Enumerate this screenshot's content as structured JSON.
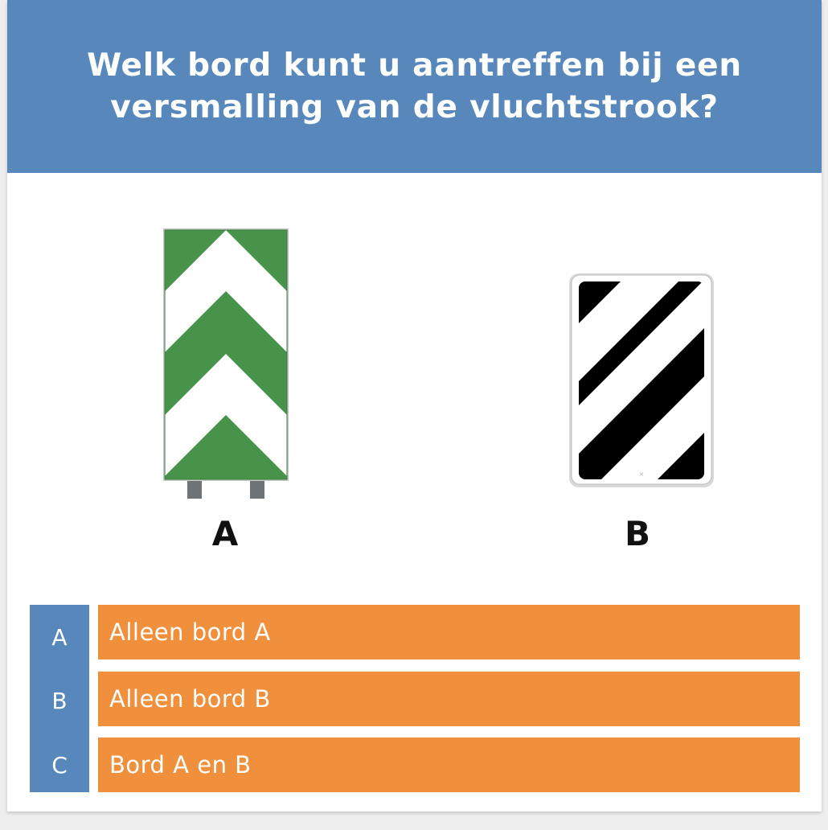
{
  "question": {
    "text": "Welk bord kunt u aantreffen bij een\nversmalling van de vluchtstrook?"
  },
  "signs": [
    {
      "label": "A",
      "icon": "green-chevron-sign-icon",
      "color_primary": "#48934a",
      "color_secondary": "#ffffff"
    },
    {
      "label": "B",
      "icon": "black-diagonal-stripe-sign-icon",
      "color_primary": "#000000",
      "color_secondary": "#ffffff"
    }
  ],
  "answers": [
    {
      "letter": "A",
      "text": "Alleen bord A"
    },
    {
      "letter": "B",
      "text": "Alleen bord B"
    },
    {
      "letter": "C",
      "text": "Bord A en B"
    }
  ],
  "colors": {
    "header": "#5888bb",
    "answer_background": "#f0903d",
    "letter_column": "#5888bb"
  }
}
